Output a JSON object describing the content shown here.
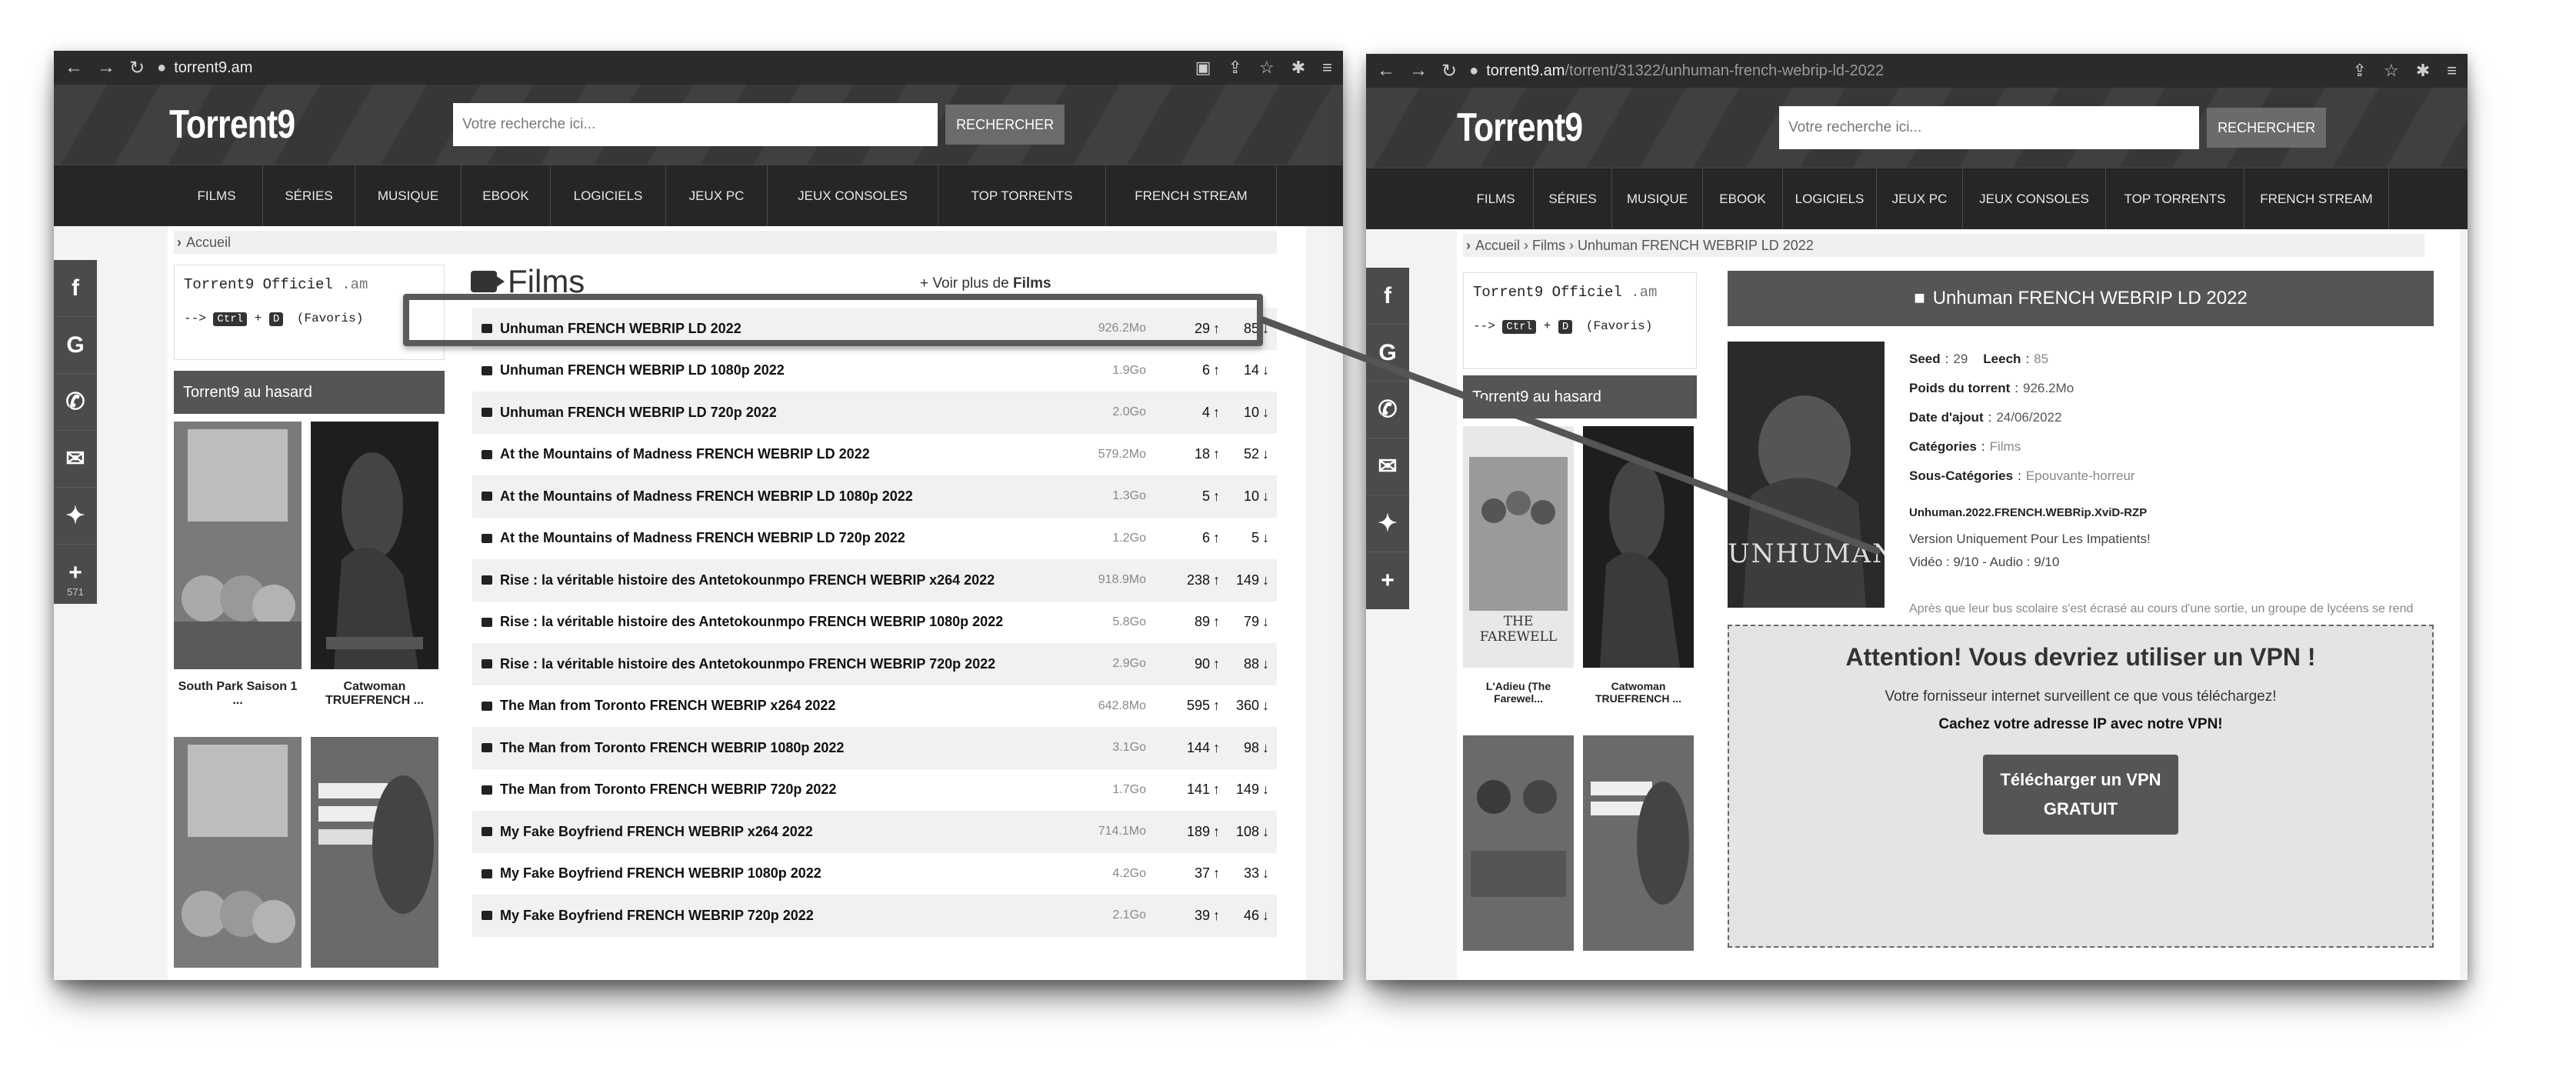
{
  "left": {
    "url": "torrent9.am",
    "logo": "Torrent9",
    "search_placeholder": "Votre recherche ici...",
    "search_button": "RECHERCHER",
    "menu": [
      "FILMS",
      "SÉRIES",
      "MUSIQUE",
      "EBOOK",
      "LOGICIELS",
      "JEUX PC",
      "JEUX CONSOLES",
      "TOP TORRENTS",
      "FRENCH STREAM"
    ],
    "breadcrumb": "Accueil",
    "official_title": "Torrent9 Officiel",
    "official_domain": ".am",
    "shortcut_prefix": "-->",
    "key_ctrl": "Ctrl",
    "key_plus": "+",
    "key_d": "D",
    "shortcut_label": "(Favoris)",
    "random_title": "Torrent9 au hasard",
    "thumb1_label": "South Park Saison 1 ...",
    "thumb2_label": "Catwoman TRUEFRENCH ...",
    "films_title": "Films",
    "more_prefix": "Voir plus de",
    "more_bold": "Films",
    "social_count": "571",
    "rows": [
      {
        "name": "Unhuman FRENCH WEBRIP LD 2022",
        "size": "926.2Mo",
        "seed": "29",
        "leech": "85"
      },
      {
        "name": "Unhuman FRENCH WEBRIP LD 1080p 2022",
        "size": "1.9Go",
        "seed": "6",
        "leech": "14"
      },
      {
        "name": "Unhuman FRENCH WEBRIP LD 720p 2022",
        "size": "2.0Go",
        "seed": "4",
        "leech": "10"
      },
      {
        "name": "At the Mountains of Madness FRENCH WEBRIP LD 2022",
        "size": "579.2Mo",
        "seed": "18",
        "leech": "52"
      },
      {
        "name": "At the Mountains of Madness FRENCH WEBRIP LD 1080p 2022",
        "size": "1.3Go",
        "seed": "5",
        "leech": "10"
      },
      {
        "name": "At the Mountains of Madness FRENCH WEBRIP LD 720p 2022",
        "size": "1.2Go",
        "seed": "6",
        "leech": "5"
      },
      {
        "name": "Rise : la véritable histoire des Antetokounmpo FRENCH WEBRIP x264 2022",
        "size": "918.9Mo",
        "seed": "238",
        "leech": "149"
      },
      {
        "name": "Rise : la véritable histoire des Antetokounmpo FRENCH WEBRIP 1080p 2022",
        "size": "5.8Go",
        "seed": "89",
        "leech": "79"
      },
      {
        "name": "Rise : la véritable histoire des Antetokounmpo FRENCH WEBRIP 720p 2022",
        "size": "2.9Go",
        "seed": "90",
        "leech": "88"
      },
      {
        "name": "The Man from Toronto FRENCH WEBRIP x264 2022",
        "size": "642.8Mo",
        "seed": "595",
        "leech": "360"
      },
      {
        "name": "The Man from Toronto FRENCH WEBRIP 1080p 2022",
        "size": "3.1Go",
        "seed": "144",
        "leech": "98"
      },
      {
        "name": "The Man from Toronto FRENCH WEBRIP 720p 2022",
        "size": "1.7Go",
        "seed": "141",
        "leech": "149"
      },
      {
        "name": "My Fake Boyfriend FRENCH WEBRIP x264 2022",
        "size": "714.1Mo",
        "seed": "189",
        "leech": "108"
      },
      {
        "name": "My Fake Boyfriend FRENCH WEBRIP 1080p 2022",
        "size": "4.2Go",
        "seed": "37",
        "leech": "33"
      },
      {
        "name": "My Fake Boyfriend FRENCH WEBRIP 720p 2022",
        "size": "2.1Go",
        "seed": "39",
        "leech": "46"
      }
    ]
  },
  "right": {
    "url_host": "torrent9.am",
    "url_path": "/torrent/31322/unhuman-french-webrip-ld-2022",
    "logo": "Torrent9",
    "search_placeholder": "Votre recherche ici...",
    "search_button": "RECHERCHER",
    "menu": [
      "FILMS",
      "SÉRIES",
      "MUSIQUE",
      "EBOOK",
      "LOGICIELS",
      "JEUX PC",
      "JEUX CONSOLES",
      "TOP TORRENTS",
      "FRENCH STREAM"
    ],
    "breadcrumb": "Accueil › Films › Unhuman FRENCH WEBRIP LD 2022",
    "official_title": "Torrent9 Officiel",
    "official_domain": ".am",
    "shortcut_prefix": "-->",
    "key_ctrl": "Ctrl",
    "key_plus": "+",
    "key_d": "D",
    "shortcut_label": "(Favoris)",
    "random_title": "Torrent9 au hasard",
    "thumb1_label": "L'Adieu (The Farewel...",
    "thumb2_label": "Catwoman TRUEFRENCH ...",
    "thumb1_caption": "THE FAREWELL",
    "detail_title": "Unhuman FRENCH WEBRIP LD 2022",
    "poster_title": "UNHUMAN",
    "seed_label": "Seed",
    "seed_value": "29",
    "leech_label": "Leech",
    "leech_value": "85",
    "size_label": "Poids du torrent",
    "size_value": "926.2Mo",
    "date_label": "Date d'ajout",
    "date_value": "24/06/2022",
    "cat_label": "Catégories",
    "cat_value": "Films",
    "subcat_label": "Sous-Catégories",
    "subcat_value": "Epouvante-horreur",
    "release": "Unhuman.2022.FRENCH.WEBRip.XviD-RZP",
    "version": "Version Uniquement Pour Les Impatients!",
    "quality": "Vidéo : 9/10 - Audio : 9/10",
    "description": "Après que leur bus scolaire s'est écrasé au cours d'une sortie, un groupe de lycéens se rend compte qu'ils sont traqués par un mystérieux agresseur. Ils vont devoir s'allier afin de survivre...",
    "vpn_title": "Attention! Vous devriez utiliser un VPN !",
    "vpn_line1": "Votre fornisseur internet surveillent ce que vous téléchargez!",
    "vpn_line2": "Cachez votre adresse IP avec notre VPN!",
    "vpn_button_line1": "Télécharger un VPN",
    "vpn_button_line2": "GRATUIT"
  },
  "colors": {
    "header": "#3a3a3a",
    "menu": "#262626",
    "accent_box": "#555555"
  },
  "icons": [
    "facebook-icon",
    "google-icon",
    "whatsapp-icon",
    "messenger-icon",
    "twitter-icon",
    "plus-icon",
    "camera-icon",
    "arrow-up-icon",
    "arrow-down-icon"
  ]
}
